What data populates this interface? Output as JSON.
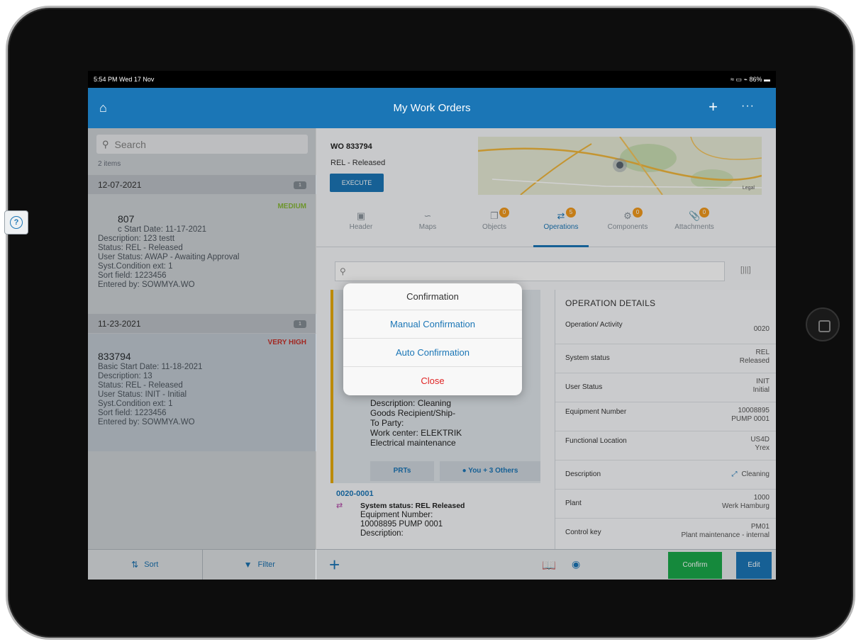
{
  "status_bar": {
    "time_date": "5:54 PM  Wed 17 Nov",
    "right": "≈ ▭ ⌁ 86% ▬"
  },
  "app_bar": {
    "title": "My Work Orders",
    "home_icon": "home-icon",
    "add_icon": "+",
    "more_icon": "···"
  },
  "left_panel": {
    "search_placeholder": "Search",
    "item_count": "2 items",
    "groups": [
      {
        "date": "12-07-2021",
        "badge": "1",
        "item": {
          "priority": "MEDIUM",
          "number": "807",
          "lines": [
            "c Start Date: 11-17-2021",
            "Description: 123 testt",
            "Status: REL - Released",
            "User Status: AWAP - Awaiting Approval",
            "Syst.Condition ext: 1",
            "Sort field: 1223456",
            "Entered by: SOWMYA.WO"
          ]
        }
      },
      {
        "date": "11-23-2021",
        "badge": "1",
        "item": {
          "priority": "VERY HIGH",
          "number": "833794",
          "lines": [
            "Basic Start Date: 11-18-2021",
            "Description: 13",
            "Status: REL - Released",
            "User Status: INIT - Initial",
            "Syst.Condition ext: 1",
            "Sort field: 1223456",
            "Entered by: SOWMYA.WO"
          ]
        }
      }
    ],
    "footer": {
      "sort": "Sort",
      "filter": "Filter"
    },
    "help_label": "?"
  },
  "right_panel": {
    "wo_number": "WO 833794",
    "status": "REL - Released",
    "execute": "EXECUTE",
    "map_label": "Legal",
    "tabs": [
      {
        "label": "Header",
        "badge": ""
      },
      {
        "label": "Maps",
        "badge": ""
      },
      {
        "label": "Objects",
        "badge": "0"
      },
      {
        "label": "Operations",
        "badge": "5"
      },
      {
        "label": "Components",
        "badge": "0"
      },
      {
        "label": "Attachments",
        "badge": "0"
      }
    ],
    "card_lines": [
      "Description: Cleaning",
      "Goods Recipient/Ship-",
      "To Party:",
      "Work center: ELEKTRIK",
      "Electrical maintenance"
    ],
    "card_buttons": {
      "prts": "PRTs",
      "assign": "You + 3 Others"
    },
    "op2": {
      "id": "0020-0001",
      "status": "System status: REL Released",
      "lines": [
        "Equipment Number:",
        "10008895 PUMP 0001",
        "Description:"
      ]
    },
    "details": {
      "title": "OPERATION DETAILS",
      "rows": [
        {
          "key": "Operation/ Activity",
          "v1": "0020",
          "v2": ""
        },
        {
          "key": "System status",
          "v1": "REL",
          "v2": "Released"
        },
        {
          "key": "User Status",
          "v1": "INIT",
          "v2": "Initial"
        },
        {
          "key": "Equipment Number",
          "v1": "10008895",
          "v2": "PUMP 0001"
        },
        {
          "key": "Functional Location",
          "v1": "US4D",
          "v2": "Yrex"
        },
        {
          "key": "Description",
          "v1": "Cleaning",
          "v2": ""
        },
        {
          "key": "Plant",
          "v1": "1000",
          "v2": "Werk Hamburg"
        },
        {
          "key": "Control key",
          "v1": "PM01",
          "v2": "Plant maintenance - internal"
        }
      ]
    },
    "footer": {
      "confirm": "Confirm",
      "edit": "Edit"
    }
  },
  "popover": {
    "title": "Confirmation",
    "manual": "Manual Confirmation",
    "auto": "Auto Confirmation",
    "close": "Close"
  },
  "colors": {
    "brand_blue": "#1b76b6",
    "confirm_green": "#1aa84a",
    "badge_orange": "#f1991d",
    "priority_red": "#d0342c",
    "priority_medium": "#8cbf3a"
  }
}
